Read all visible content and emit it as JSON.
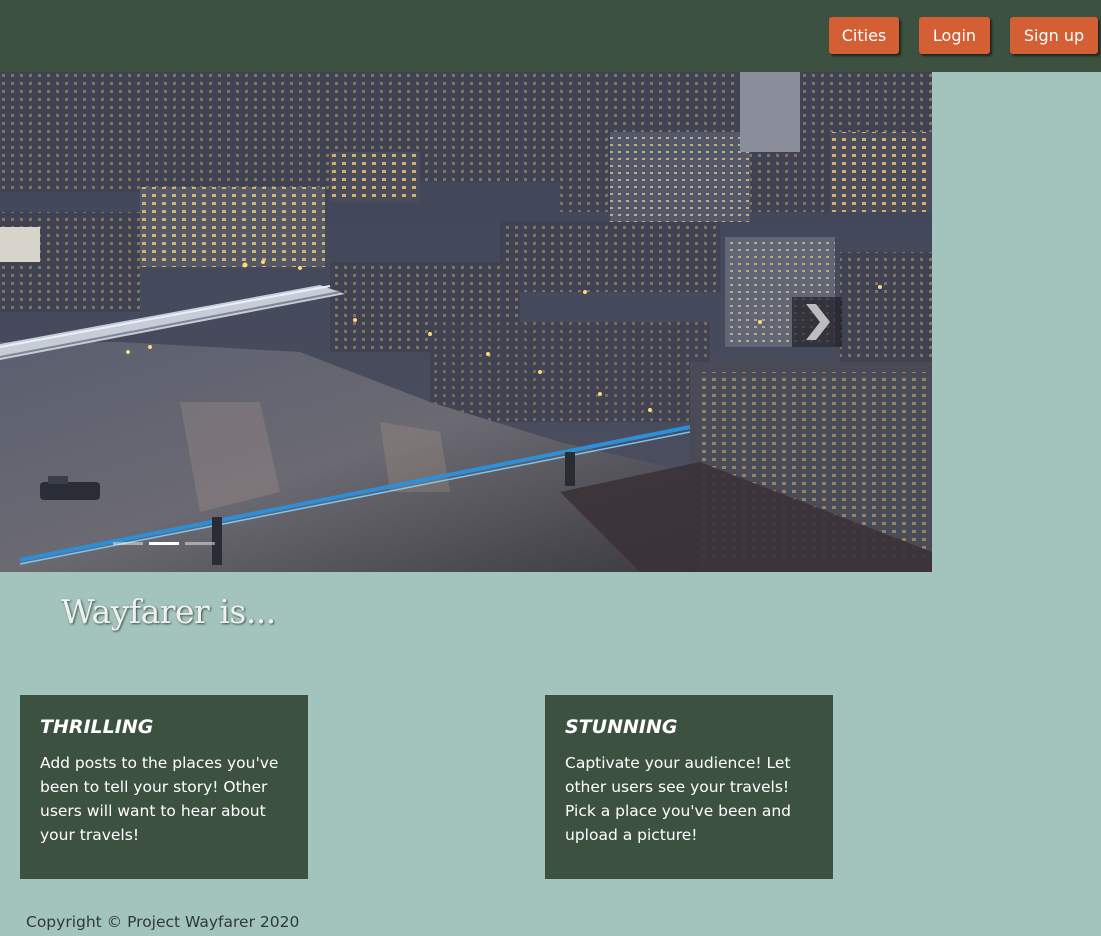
{
  "nav": {
    "cities_label": "Cities",
    "login_label": "Login",
    "signup_label": "Sign up"
  },
  "carousel": {
    "image_alt": "Aerial view of a city along a river at dusk with a lit footbridge",
    "slide_count": 3,
    "active_slide": 2,
    "next_icon": "chevron-right-icon"
  },
  "main": {
    "headline": "Wayfarer is...",
    "cards": [
      {
        "title": "THRILLING",
        "text": "Add posts to the places you've been to tell your story! Other users will want to hear about your travels!"
      },
      {
        "title": "STUNNING",
        "text": "Captivate your audience! Let other users see your travels! Pick a place you've been and upload a picture!"
      }
    ]
  },
  "footer": {
    "copyright": "Copyright © Project Wayfarer 2020"
  },
  "colors": {
    "background": "#a3c4bc",
    "navbar": "#3c513f",
    "accent_button": "#d55f35",
    "card": "#3c513f"
  }
}
